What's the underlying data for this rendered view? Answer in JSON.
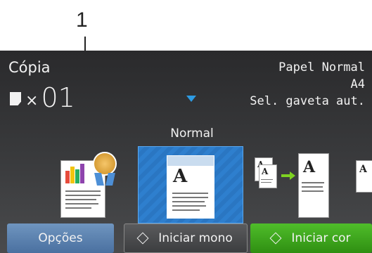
{
  "callout": {
    "number": "1"
  },
  "screen": {
    "title": "Cópia",
    "copies": {
      "times_symbol": "×",
      "count": "01"
    },
    "status": [
      "Papel Normal",
      "A4",
      "Sel. gaveta aut."
    ],
    "mode_label": "Normal",
    "accent_color": "#2d9be3"
  },
  "carousel": {
    "items": [
      {
        "name": "Qualidade",
        "icon": "ribbon-award-document-icon"
      },
      {
        "name": "Normal",
        "icon": "single-document-icon",
        "selected": true
      },
      {
        "name": "2 em 1",
        "icon": "two-pages-to-one-icon"
      },
      {
        "name": "Partial",
        "icon": "document-partial-icon"
      }
    ]
  },
  "buttons": {
    "options": "Opções",
    "start_mono": "Iniciar mono",
    "start_color": "Iniciar cor"
  }
}
